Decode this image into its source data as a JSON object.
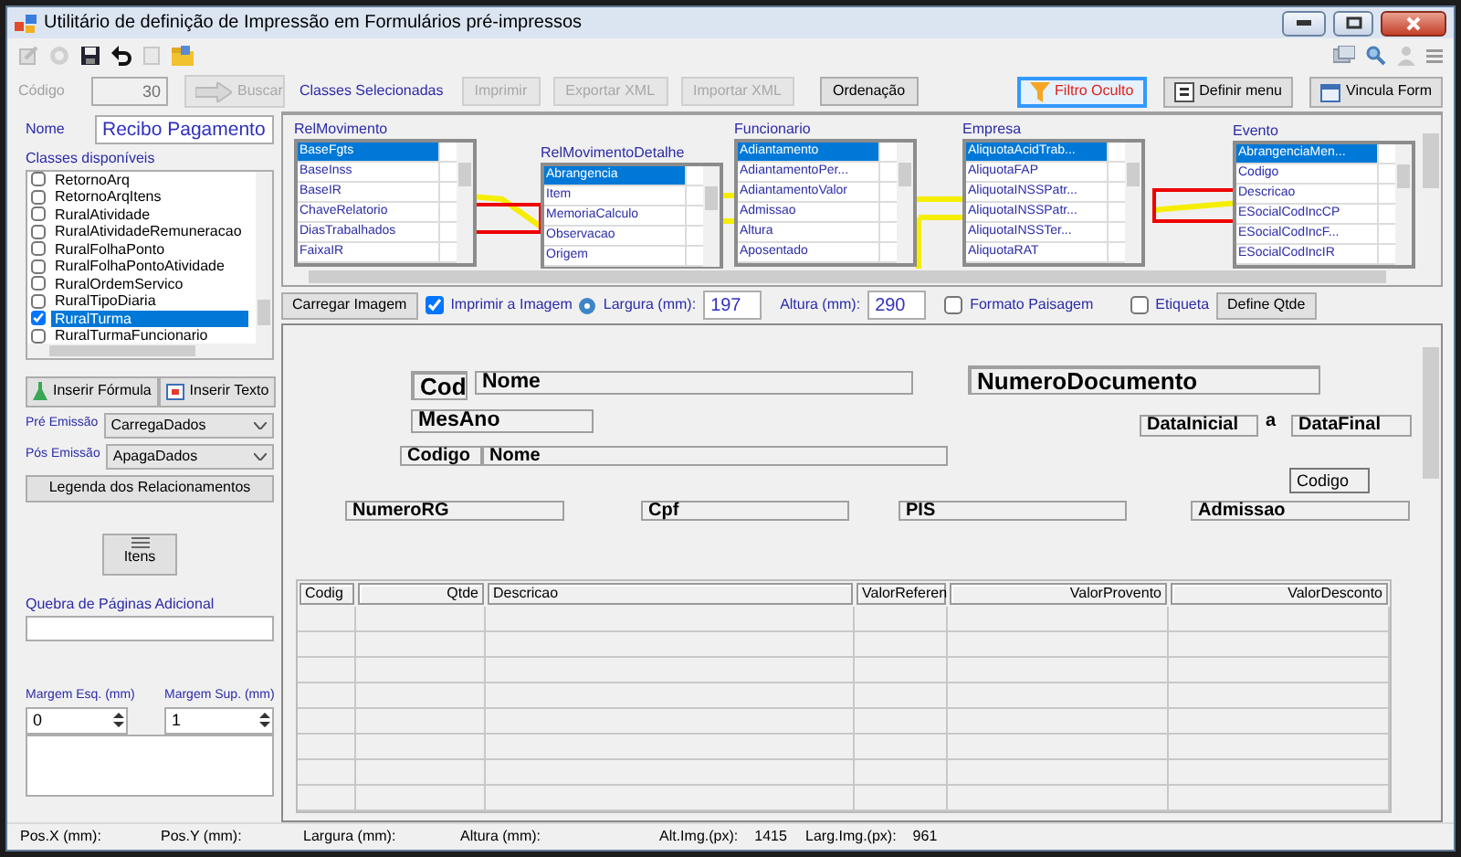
{
  "window": {
    "title": "Utilitário de definição de Impressão em Formulários pré-impressos"
  },
  "top_bar": {
    "code_label": "Código",
    "code_value": "30",
    "code_disabled": true,
    "search_button": {
      "label": "Buscar",
      "disabled": true
    },
    "classes_label": "Classes Selecionadas",
    "buttons": [
      {
        "label": "Imprimir",
        "disabled": true
      },
      {
        "label": "Exportar XML",
        "disabled": true
      },
      {
        "label": "Importar XML",
        "disabled": true
      },
      {
        "label": "Ordenação",
        "disabled": false
      }
    ],
    "right_buttons": [
      {
        "label": "Filtro Oculto",
        "kind": "filter",
        "active": true
      },
      {
        "label": "Definir menu",
        "kind": "menu",
        "active": false
      },
      {
        "label": "Vincula Form",
        "kind": "calendar",
        "active": false
      }
    ]
  },
  "left_panel": {
    "name_label": "Nome",
    "name_value": "Recibo Pagamento",
    "classes_label": "Classes disponíveis",
    "classes": [
      {
        "label": "RetornoArq",
        "checked": false,
        "selected": false
      },
      {
        "label": "RetornoArqItens",
        "checked": false,
        "selected": false
      },
      {
        "label": "RuralAtividade",
        "checked": false,
        "selected": false
      },
      {
        "label": "RuralAtividadeRemuneracao",
        "checked": false,
        "selected": false
      },
      {
        "label": "RuralFolhaPonto",
        "checked": false,
        "selected": false
      },
      {
        "label": "RuralFolhaPontoAtividade",
        "checked": false,
        "selected": false
      },
      {
        "label": "RuralOrdemServico",
        "checked": false,
        "selected": false
      },
      {
        "label": "RuralTipoDiaria",
        "checked": false,
        "selected": false
      },
      {
        "label": "RuralTurma",
        "checked": true,
        "selected": true
      },
      {
        "label": "RuralTurmaFuncionario",
        "checked": false,
        "selected": false
      }
    ],
    "formula_button": "Inserir Fórmula",
    "text_button": "Inserir Texto",
    "pre_emission": {
      "label": "Pré Emissão",
      "value": "CarregaDados"
    },
    "post_emission": {
      "label": "Pós Emissão",
      "value": "ApagaDados"
    },
    "legend_button": "Legenda dos Relacionamentos",
    "items_button": "Itens",
    "page_break": {
      "label": "Quebra de Páginas Adicional"
    },
    "margins": [
      {
        "label": "Margem Esq. (mm)",
        "value": "0"
      },
      {
        "label": "Margem Sup. (mm)",
        "value": "1"
      }
    ]
  },
  "diagram": {
    "tables": [
      {
        "title": "RelMovimento",
        "items": [
          {
            "label": "BaseFgts",
            "selected": true
          },
          {
            "label": "BaseInss",
            "selected": false
          },
          {
            "label": "BaseIR",
            "selected": false
          },
          {
            "label": "ChaveRelatorio",
            "selected": false
          },
          {
            "label": "DiasTrabalhados",
            "selected": false
          },
          {
            "label": "FaixaIR",
            "selected": false
          }
        ]
      },
      {
        "title": "RelMovimentoDetalhe",
        "items": [
          {
            "label": "Abrangencia",
            "selected": true
          },
          {
            "label": "Item",
            "selected": false
          },
          {
            "label": "MemoriaCalculo",
            "selected": false
          },
          {
            "label": "Observacao",
            "selected": false
          },
          {
            "label": "Origem",
            "selected": false
          }
        ]
      },
      {
        "title": "Funcionario",
        "items": [
          {
            "label": "Adiantamento",
            "selected": true
          },
          {
            "label": "AdiantamentoPer...",
            "selected": false
          },
          {
            "label": "AdiantamentoValor",
            "selected": false
          },
          {
            "label": "Admissao",
            "selected": false
          },
          {
            "label": "Altura",
            "selected": false
          },
          {
            "label": "Aposentado",
            "selected": false
          }
        ]
      },
      {
        "title": "Empresa",
        "items": [
          {
            "label": "AliquotaAcidTrab...",
            "selected": true
          },
          {
            "label": "AliquotaFAP",
            "selected": false
          },
          {
            "label": "AliquotaINSSPatr...",
            "selected": false
          },
          {
            "label": "AliquotaINSSPatr...",
            "selected": false
          },
          {
            "label": "AliquotaINSSTer...",
            "selected": false
          },
          {
            "label": "AliquotaRAT",
            "selected": false
          }
        ]
      },
      {
        "title": "Evento",
        "items": [
          {
            "label": "AbrangenciaMen...",
            "selected": true
          },
          {
            "label": "Codigo",
            "selected": false
          },
          {
            "label": "Descricao",
            "selected": false
          },
          {
            "label": "ESocialCodIncCP",
            "selected": false
          },
          {
            "label": "ESocialCodIncF...",
            "selected": false
          },
          {
            "label": "ESocialCodIncIR",
            "selected": false
          }
        ]
      }
    ]
  },
  "image_toolbar": {
    "load_button": "Carregar Imagem",
    "print_image": {
      "label": "Imprimir a Imagem",
      "checked": true
    },
    "width": {
      "label": "Largura (mm):",
      "value": "197"
    },
    "height": {
      "label": "Altura (mm):",
      "value": "290"
    },
    "landscape": {
      "label": "Formato Paisagem",
      "checked": false
    },
    "tag": {
      "label": "Etiqueta",
      "checked": false
    },
    "quantity_button": "Define Qtde"
  },
  "canvas": {
    "fields": [
      {
        "text": "Cod",
        "kind": "large"
      },
      {
        "text": "Nome",
        "kind": "medium"
      },
      {
        "text": "NumeroDocumento",
        "kind": "large"
      },
      {
        "text": "MesAno",
        "kind": "medium"
      },
      {
        "text": "DataInicial",
        "kind": "bold"
      },
      {
        "text": "a",
        "kind": "label"
      },
      {
        "text": "DataFinal",
        "kind": "bold"
      },
      {
        "text": "Codigo",
        "kind": "bold"
      },
      {
        "text": "Nome",
        "kind": "bold"
      },
      {
        "text": "Codigo",
        "kind": "plain"
      },
      {
        "text": "NumeroRG",
        "kind": "bold"
      },
      {
        "text": "Cpf",
        "kind": "bold"
      },
      {
        "text": "PIS",
        "kind": "bold"
      },
      {
        "text": "Admissao",
        "kind": "bold"
      }
    ],
    "grid_columns": [
      "Codig",
      "Qtde",
      "Descricao",
      "ValorReferen",
      "ValorProvento",
      "ValorDesconto"
    ]
  },
  "status_bar": [
    {
      "label": "Pos.X (mm):"
    },
    {
      "label": "Pos.Y (mm):"
    },
    {
      "label": "Largura (mm):"
    },
    {
      "label": "Altura (mm):"
    },
    {
      "label": "Alt.Img.(px):",
      "value": "1415"
    },
    {
      "label": "Larg.Img.(px):",
      "value": "961"
    }
  ]
}
